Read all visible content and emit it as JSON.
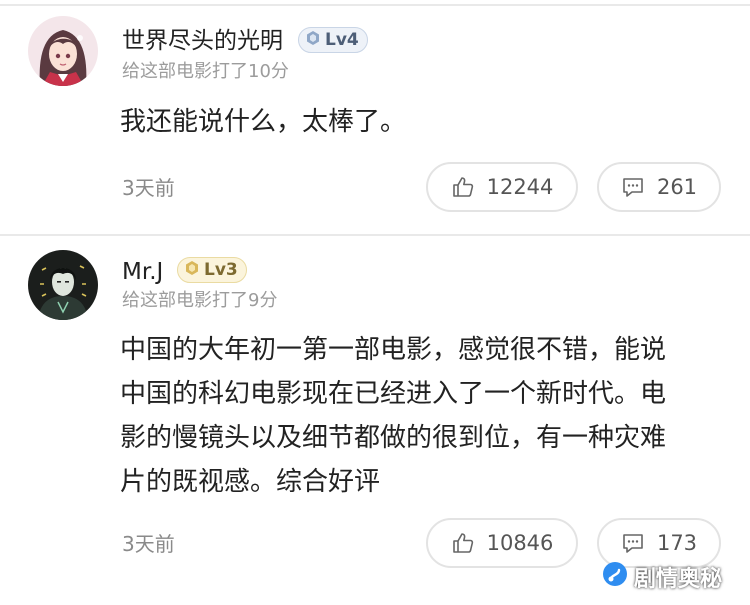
{
  "comments": [
    {
      "username": "世界尽头的光明",
      "level": "Lv4",
      "rated": "给这部电影打了10分",
      "text_lines": [
        "我还能说什么，太棒了。"
      ],
      "time": "3天前",
      "likes": "12244",
      "replies": "261",
      "level_color": "#4d5e77"
    },
    {
      "username": "Mr.J",
      "level": "Lv3",
      "rated": "给这部电影打了9分",
      "text_lines": [
        "中国的大年初一第一部电影，感觉很不错，能说",
        "中国的科幻电影现在已经进入了一个新时代。电",
        "影的慢镜头以及细节都做的很到位，有一种灾难",
        "片的既视感。综合好评"
      ],
      "time": "3天前",
      "likes": "10846",
      "replies": "173",
      "level_color": "#7d6a30"
    }
  ],
  "watermark": {
    "text": "剧情奥秘",
    "icon": "play-note-icon"
  },
  "icons": {
    "like": "thumbs-up-icon",
    "reply": "comment-bubble-icon"
  }
}
